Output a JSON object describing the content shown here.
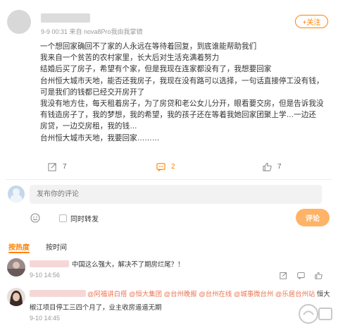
{
  "post": {
    "meta": "9-9 00:31  来自 nova8Pro我由我掌镜",
    "follow_label": "+关注",
    "lines": [
      "一个想回家确回不了家的人永远在等待着回复，到底谁能帮助我们",
      "我来自一个贫苦的农村家里，长大后对生活充满着努力",
      "结婚后买了房子，希望有个家，但是我现在连家都没有了，我想要回家",
      "台州恒大城市天地，能否还我房子，我现在没有路可以选择，一句话直接停工没有钱，",
      "可是我们的钱都已经交开房开了",
      "我没有地方住，每天租着房子，为了房贷和老公女儿分开，眼看要交房，但是告诉我没",
      "有钱造房子了，我的梦想，我的希望，我的孩子还在等着我她回家团聚上学…一边还",
      "房贷，一边交房租，我的钱…",
      "台州恒大城市天地，我要回家………"
    ],
    "actions": {
      "forward_count": "7",
      "comment_count": "2",
      "like_count": "7"
    }
  },
  "comment_box": {
    "placeholder": "发布你的评论",
    "forward_checkbox_label": "同时转发",
    "submit_label": "评论"
  },
  "tabs": [
    {
      "label": "按热度",
      "active": true
    },
    {
      "label": "按时间",
      "active": false
    }
  ],
  "replies": [
    {
      "text": "中国这么强大，解决不了期房烂尾？！",
      "time": "9-10 14:56"
    },
    {
      "mentions": "@阿福讲白搭 @恒大集团 @台州晚报 @台州在线 @城事微台州 @乐居台州站",
      "tail": " 恒大",
      "line2": "椒江项目停工三四个月了，业主收房遥遥无期",
      "time": "9-10 14:45"
    }
  ],
  "colors": {
    "accent": "#ff8200",
    "link": "#eb7350",
    "submit_disabled": "#ffb366"
  },
  "icons": [
    "forward-icon",
    "comment-icon",
    "like-icon",
    "emoji-icon",
    "share-icon",
    "reply-icon",
    "thumb-icon"
  ]
}
